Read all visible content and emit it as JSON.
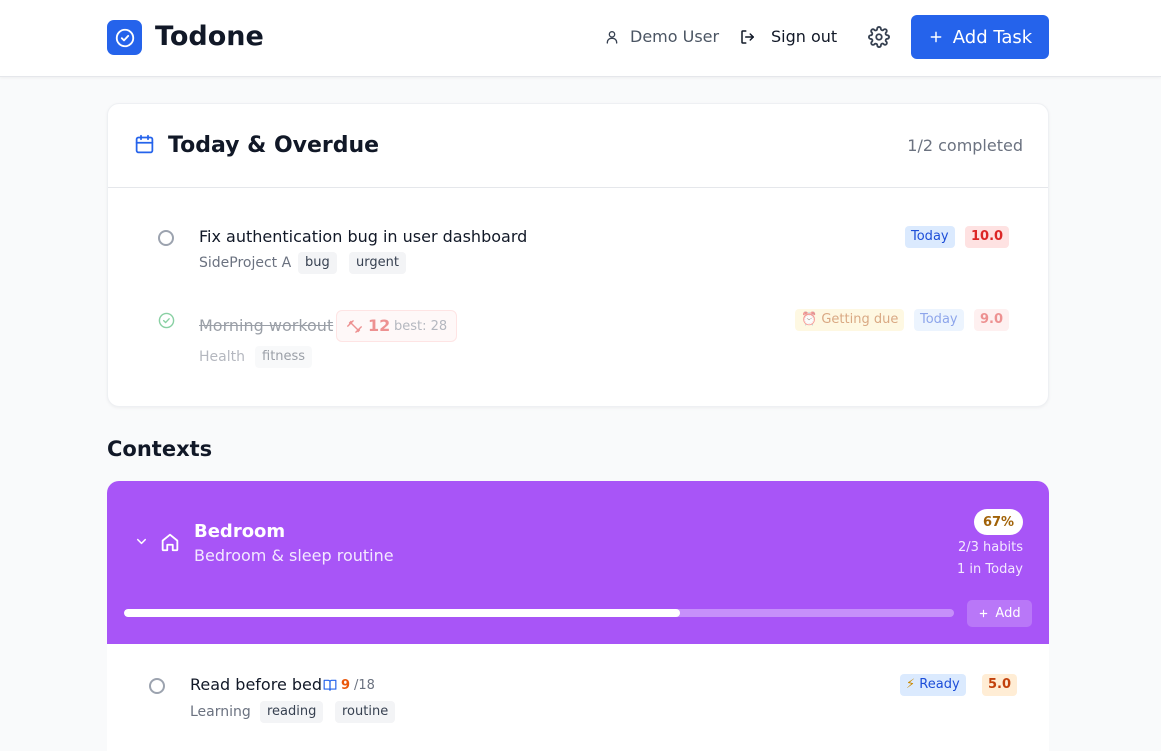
{
  "header": {
    "app_title": "Todone",
    "logo_icon": "check-circle-icon",
    "user_name": "Demo User",
    "sign_out_label": "Sign out",
    "add_task_label": "Add Task",
    "accent_color": "#2563eb"
  },
  "today": {
    "title": "Today & Overdue",
    "completed_text": "1/2 completed",
    "tasks": [
      {
        "title": "Fix authentication bug in user dashboard",
        "project": "SideProject A",
        "tags": [
          "bug",
          "urgent"
        ],
        "due_badge": "Today",
        "score": "10.0",
        "completed": false
      },
      {
        "title": "Morning workout",
        "project": "Health",
        "tags": [
          "fitness"
        ],
        "streak": "12",
        "streak_best": "best: 28",
        "status_badge": "Getting due",
        "due_badge": "Today",
        "score": "9.0",
        "completed": true
      }
    ]
  },
  "contexts": {
    "section_title": "Contexts",
    "items": [
      {
        "name": "Bedroom",
        "description": "Bedroom & sleep routine",
        "percent": "67%",
        "progress": 0.67,
        "habits_text": "2/3 habits",
        "today_text": "1 in Today",
        "add_label": "Add",
        "color": "#a855f7",
        "tasks": [
          {
            "title": "Read before bed",
            "progress_current": "9",
            "progress_total": "/18",
            "project": "Learning",
            "tags": [
              "reading",
              "routine"
            ],
            "status_badge": "Ready",
            "score": "5.0"
          }
        ]
      }
    ]
  }
}
